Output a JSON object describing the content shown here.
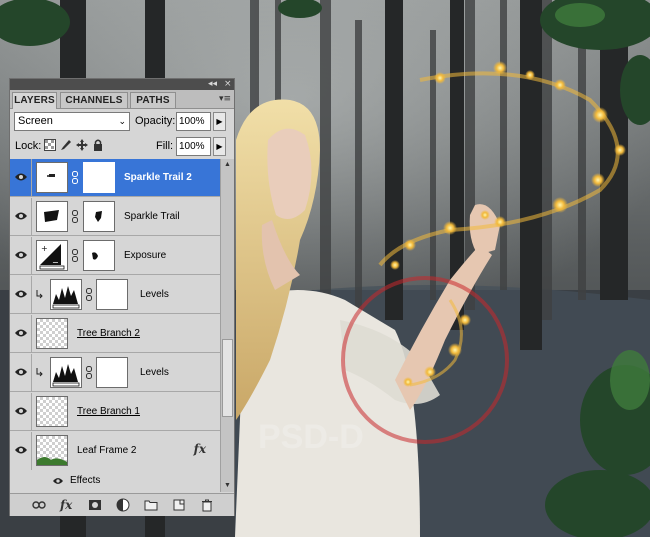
{
  "panel": {
    "tabs": [
      {
        "label": "LAYERS",
        "active": true
      },
      {
        "label": "CHANNELS",
        "active": false
      },
      {
        "label": "PATHS",
        "active": false
      }
    ],
    "title_controls": {
      "collapse": "◂◂",
      "close": "×"
    },
    "menu_glyph": "▾≡",
    "blend_mode": "Screen",
    "opacity_label": "Opacity:",
    "opacity_value": "100%",
    "lock_label": "Lock:",
    "fill_label": "Fill:",
    "fill_value": "100%",
    "selected_color": "#3875d7",
    "layers": [
      {
        "name": "Sparkle Trail 2",
        "kind": "masked",
        "selected": true,
        "visible": true,
        "underline": false
      },
      {
        "name": "Sparkle Trail",
        "kind": "masked",
        "selected": false,
        "visible": true,
        "underline": false
      },
      {
        "name": "Exposure",
        "kind": "adjustment",
        "selected": false,
        "visible": true,
        "underline": false
      },
      {
        "name": "Levels",
        "kind": "levels-clipped",
        "selected": false,
        "visible": true,
        "underline": false
      },
      {
        "name": "Tree Branch 2",
        "kind": "smart",
        "selected": false,
        "visible": true,
        "underline": true
      },
      {
        "name": "Levels",
        "kind": "levels-clipped",
        "selected": false,
        "visible": true,
        "underline": false
      },
      {
        "name": "Tree Branch 1",
        "kind": "smart",
        "selected": false,
        "visible": true,
        "underline": true
      },
      {
        "name": "Leaf Frame 2",
        "kind": "fx",
        "selected": false,
        "visible": true,
        "underline": false
      }
    ],
    "effects_label": "Effects",
    "fx_glyph": "fx",
    "bottom_icons": [
      "link-layers-icon",
      "fx-icon",
      "add-mask-icon",
      "adjustment-layer-icon",
      "new-group-icon",
      "new-layer-icon",
      "trash-icon"
    ]
  },
  "artwork": {
    "watermark": "PSD-D",
    "accent_color": "#c8282c"
  }
}
